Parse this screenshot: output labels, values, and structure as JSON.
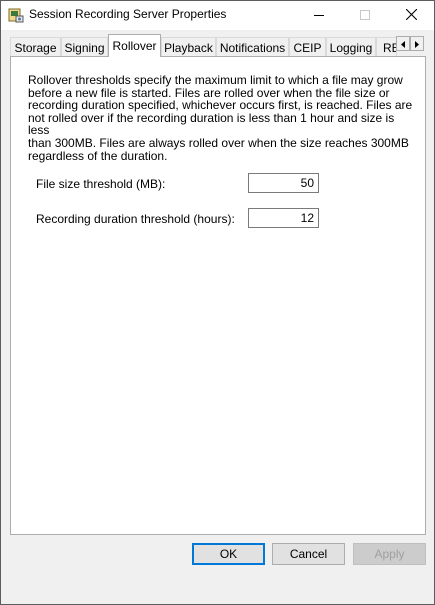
{
  "window": {
    "title": "Session Recording Server Properties"
  },
  "tabs": [
    {
      "label": "Storage",
      "active": false
    },
    {
      "label": "Signing",
      "active": false
    },
    {
      "label": "Rollover",
      "active": true
    },
    {
      "label": "Playback",
      "active": false
    },
    {
      "label": "Notifications",
      "active": false
    },
    {
      "label": "CEIP",
      "active": false
    },
    {
      "label": "Logging",
      "active": false
    },
    {
      "label": "RE",
      "active": false
    }
  ],
  "rollover": {
    "description_lines": [
      "Rollover thresholds specify the maximum limit to which a file may grow",
      "before a new file is started. Files are rolled over when the file size or",
      "recording duration specified, whichever occurs first, is reached. Files are",
      "not rolled over if the recording duration is less than 1 hour and size is less",
      "than 300MB. Files are always rolled over when the size reaches 300MB",
      "regardless of the duration."
    ],
    "file_size_label": "File size threshold (MB):",
    "file_size_value": "50",
    "duration_label": "Recording duration threshold (hours):",
    "duration_value": "12"
  },
  "buttons": {
    "ok": "OK",
    "cancel": "Cancel",
    "apply": "Apply"
  },
  "colors": {
    "accent": "#0078d7",
    "window_bg": "#f0f0f0",
    "panel_bg": "#ffffff"
  }
}
